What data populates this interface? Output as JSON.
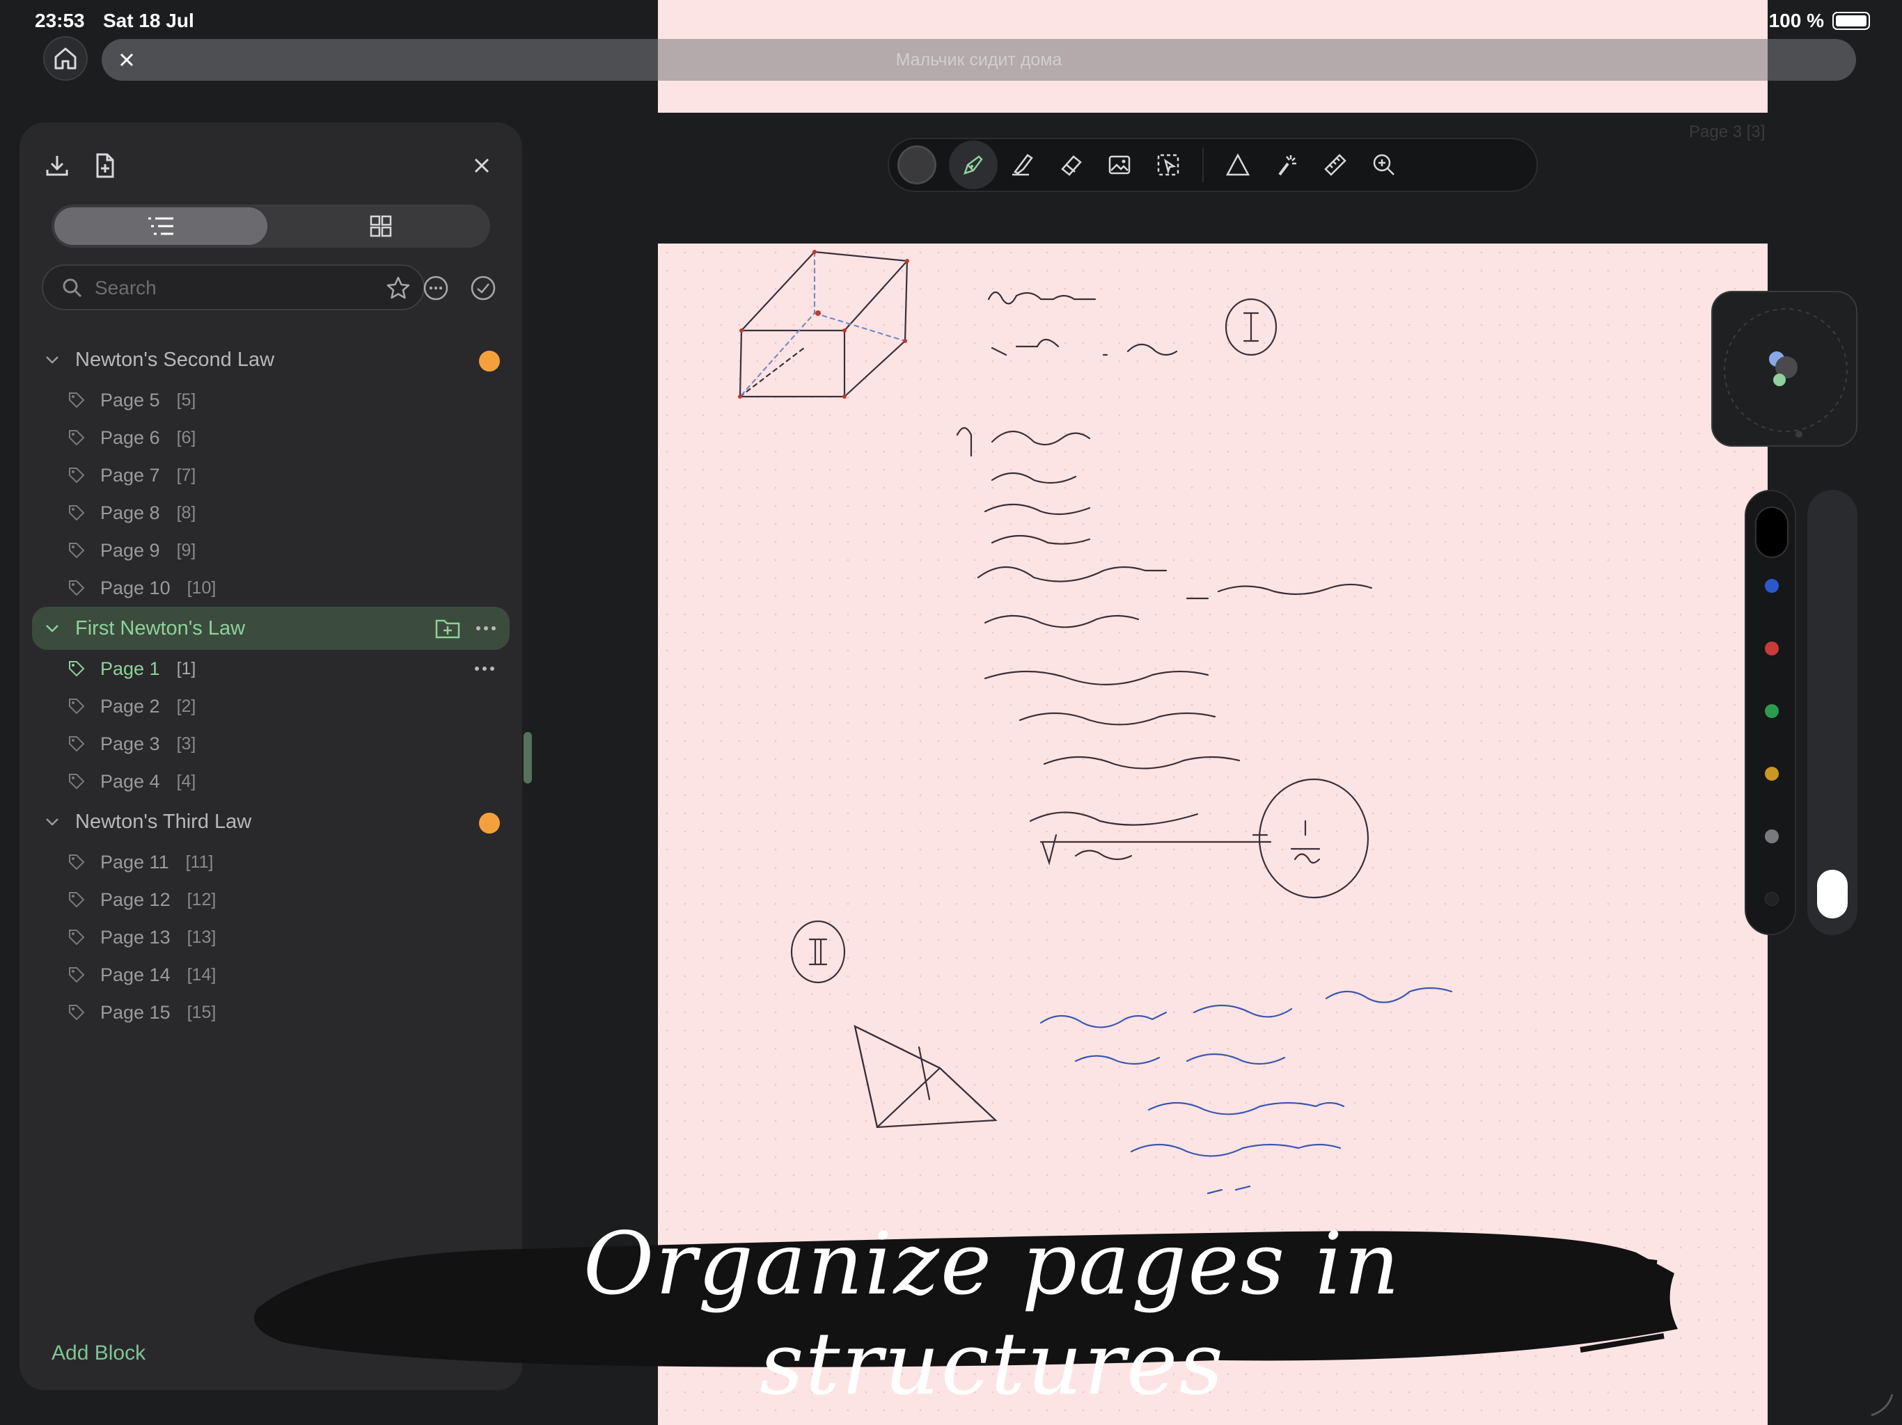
{
  "status": {
    "time": "23:53",
    "date": "Sat 18 Jul",
    "battery": "100 %"
  },
  "document": {
    "title": "Мальчик сидит дома",
    "page_indicator": "Page 3  [3]"
  },
  "sidebar": {
    "search_placeholder": "Search",
    "groups": [
      {
        "name": "Newton's Second Law",
        "dot_color": "#f5a13b",
        "pages": [
          {
            "label": "Page 5",
            "num": "[5]"
          },
          {
            "label": "Page 6",
            "num": "[6]"
          },
          {
            "label": "Page 7",
            "num": "[7]"
          },
          {
            "label": "Page 8",
            "num": "[8]"
          },
          {
            "label": "Page 9",
            "num": "[9]"
          },
          {
            "label": "Page 10",
            "num": "[10]"
          }
        ]
      },
      {
        "name": "First Newton's Law",
        "selected": true,
        "pages": [
          {
            "label": "Page 1",
            "num": "[1]"
          },
          {
            "label": "Page 2",
            "num": "[2]"
          },
          {
            "label": "Page 3",
            "num": "[3]"
          },
          {
            "label": "Page 4",
            "num": "[4]"
          }
        ]
      },
      {
        "name": "Newton's Third Law",
        "dot_color": "#f5a13b",
        "pages": [
          {
            "label": "Page 11",
            "num": "[11]"
          },
          {
            "label": "Page 12",
            "num": "[12]"
          },
          {
            "label": "Page 13",
            "num": "[13]"
          },
          {
            "label": "Page 14",
            "num": "[14]"
          },
          {
            "label": "Page 15",
            "num": "[15]"
          }
        ]
      }
    ],
    "add_block": "Add Block"
  },
  "toolbar": {
    "tools": [
      "color-swatch",
      "pen",
      "highlighter",
      "eraser",
      "image",
      "lasso-select",
      "shape",
      "laser-pointer",
      "ruler",
      "zoom"
    ],
    "active_tool": "pen",
    "accent_color": "#8fd19e"
  },
  "palette": {
    "colors": [
      "#000000",
      "#2c58c9",
      "#c93a3a",
      "#2e9a4c",
      "#c9981f",
      "#7a7a7e",
      "#222222"
    ]
  },
  "banner": {
    "text": "Organize pages in structures"
  }
}
